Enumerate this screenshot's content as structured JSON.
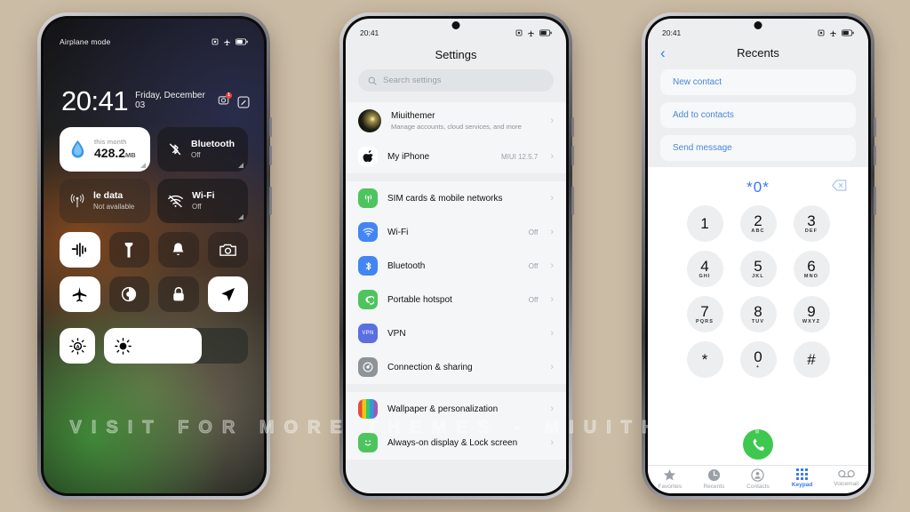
{
  "background_color": "#cbbca6",
  "watermark": "VISIT FOR MORE THEMES - MIUITHEMER.COM",
  "control_center": {
    "status": {
      "label": "Airplane mode",
      "icons": [
        "alarm-icon",
        "airplane-icon",
        "battery-icon"
      ]
    },
    "time": "20:41",
    "date": "Friday, December 03",
    "header_icons": [
      "camera-badge-icon",
      "edit-icon"
    ],
    "camera_badge_count": "1",
    "data_tile": {
      "caption": "this month",
      "value": "428.2",
      "unit": "MB"
    },
    "bluetooth_tile": {
      "title": "Bluetooth",
      "status": "Off"
    },
    "mobile_data_tile": {
      "title": "le data",
      "status": "Not available"
    },
    "wifi_tile": {
      "title": "Wi-Fi",
      "status": "Off"
    },
    "toggles": [
      {
        "name": "sound-wave-icon",
        "on": true
      },
      {
        "name": "flashlight-icon",
        "on": false
      },
      {
        "name": "bell-icon",
        "on": false
      },
      {
        "name": "camera-icon",
        "on": false
      },
      {
        "name": "airplane-icon",
        "on": true
      },
      {
        "name": "dark-mode-icon",
        "on": false
      },
      {
        "name": "lock-icon",
        "on": false
      },
      {
        "name": "location-icon",
        "on": true
      }
    ],
    "brightness": {
      "auto_icon": "auto-brightness-icon",
      "slider_icon": "brightness-icon",
      "level": "68"
    }
  },
  "settings": {
    "status_time": "20:41",
    "status_icons": [
      "alarm-icon",
      "airplane-icon",
      "battery-icon"
    ],
    "title": "Settings",
    "search": {
      "placeholder": "Search settings",
      "icon": "search-icon"
    },
    "account": {
      "name": "Miuithemer",
      "subtitle": "Manage accounts, cloud services, and more",
      "avatar": "profile-avatar"
    },
    "device": {
      "name": "My iPhone",
      "value": "MIUI 12.5.7",
      "icon": "apple-icon"
    },
    "items": [
      {
        "label": "SIM cards & mobile networks",
        "value": "",
        "icon": "sim-icon",
        "color": "#4ec45f"
      },
      {
        "label": "Wi-Fi",
        "value": "Off",
        "icon": "wifi-icon",
        "color": "#4285f4"
      },
      {
        "label": "Bluetooth",
        "value": "Off",
        "icon": "bluetooth-icon",
        "color": "#4285f4"
      },
      {
        "label": "Portable hotspot",
        "value": "Off",
        "icon": "hotspot-icon",
        "color": "#4ec45f"
      },
      {
        "label": "VPN",
        "value": "",
        "icon": "vpn-icon",
        "color": "#5a6fe0"
      },
      {
        "label": "Connection & sharing",
        "value": "",
        "icon": "connection-icon",
        "color": "#8e9398"
      }
    ],
    "items2": [
      {
        "label": "Wallpaper & personalization",
        "value": "",
        "icon": "wallpaper-icon",
        "color": "#e24a4a"
      },
      {
        "label": "Always-on display & Lock screen",
        "value": "",
        "icon": "aod-icon",
        "color": "#4ec45f"
      }
    ]
  },
  "dialer": {
    "status_time": "20:41",
    "status_icons": [
      "alarm-icon",
      "airplane-icon",
      "battery-icon"
    ],
    "back_icon": "back-chevron-icon",
    "title": "Recents",
    "actions": [
      "New contact",
      "Add to contacts",
      "Send message"
    ],
    "entered_number": "*0*",
    "delete_icon": "backspace-icon",
    "keys": [
      {
        "digit": "1",
        "sub": ""
      },
      {
        "digit": "2",
        "sub": "ABC"
      },
      {
        "digit": "3",
        "sub": "DEF"
      },
      {
        "digit": "4",
        "sub": "GHI"
      },
      {
        "digit": "5",
        "sub": "JKL"
      },
      {
        "digit": "6",
        "sub": "MNO"
      },
      {
        "digit": "7",
        "sub": "PQRS"
      },
      {
        "digit": "8",
        "sub": "TUV"
      },
      {
        "digit": "9",
        "sub": "WXYZ"
      },
      {
        "digit": "*",
        "sub": ""
      },
      {
        "digit": "0",
        "sub": "+"
      },
      {
        "digit": "#",
        "sub": ""
      }
    ],
    "call_button_color": "#3ec84f",
    "tabs": [
      {
        "label": "Favorites",
        "icon": "star-icon",
        "active": false
      },
      {
        "label": "Recents",
        "icon": "clock-icon",
        "active": false
      },
      {
        "label": "Contacts",
        "icon": "person-icon",
        "active": false
      },
      {
        "label": "Keypad",
        "icon": "keypad-icon",
        "active": true
      },
      {
        "label": "Voicemail",
        "icon": "voicemail-icon",
        "active": false
      }
    ]
  }
}
